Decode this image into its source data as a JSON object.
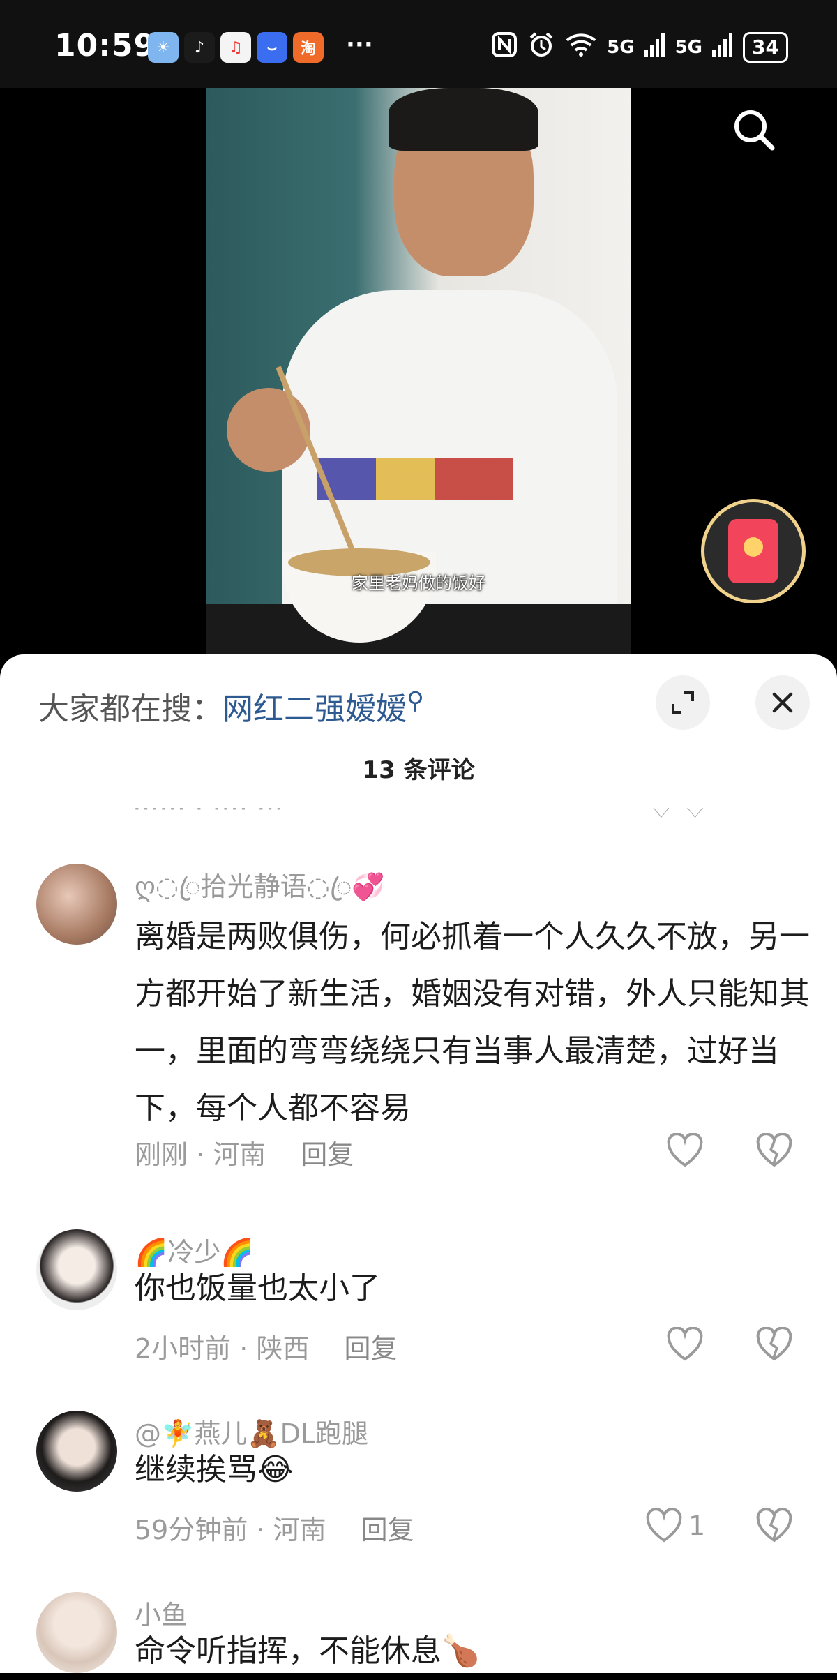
{
  "status_bar": {
    "time": "10:59",
    "more": "···",
    "network1": "5G",
    "network2": "5G",
    "battery": "34",
    "apps": [
      {
        "icon": "weather-app-icon",
        "color": "#7fb6f0",
        "glyph": "☀"
      },
      {
        "icon": "tiktok-app-icon",
        "color": "#1b1b1b",
        "glyph": "♪"
      },
      {
        "icon": "music-app-icon",
        "color": "#f4f4f4",
        "glyph": "♫"
      },
      {
        "icon": "honor-store-icon",
        "color": "#3b6df0",
        "glyph": "⌣"
      },
      {
        "icon": "taobao-app-icon",
        "color": "#f06a2a",
        "glyph": "淘"
      }
    ]
  },
  "video": {
    "subtitle": "家里老妈做的饭好"
  },
  "sheet": {
    "hot_search_prefix": "大家都在搜：",
    "hot_search_term": "网红二强嫒嫒",
    "comment_count": "13 条评论",
    "cutoff_left": "······ · ····  ···",
    "cutoff_right": "♡  ♡"
  },
  "comments": [
    {
      "username": "ღ◌ꦿ拾光静语◌ꦿ💞",
      "text": "离婚是两败俱伤，何必抓着一个人久久不放，另一方都开始了新生活，婚姻没有对错，外人只能知其一，里面的弯弯绕绕只有当事人最清楚，过好当下，每个人都不容易",
      "time": "刚刚",
      "location": "河南",
      "reply": "回复",
      "likes": ""
    },
    {
      "username": "🌈冷少🌈",
      "text": "你也饭量也太小了",
      "time": "2小时前",
      "location": "陕西",
      "reply": "回复",
      "likes": ""
    },
    {
      "username": "@🧚燕儿🧸DL跑腿",
      "text": "继续挨骂😂",
      "time": "59分钟前",
      "location": "河南",
      "reply": "回复",
      "likes": "1"
    },
    {
      "username": "小鱼",
      "text": "命令听指挥，不能休息🍗",
      "time": "",
      "location": "",
      "reply": "",
      "likes": ""
    }
  ],
  "colors": {
    "accent_link": "#2e5a92",
    "muted_text": "#9a9a9a",
    "redpacket": "#f2445a"
  }
}
